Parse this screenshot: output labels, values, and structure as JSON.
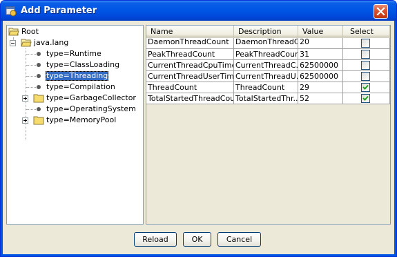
{
  "window": {
    "title": "Add Parameter"
  },
  "tree": {
    "root_label": "Root",
    "java_lang_label": "java.lang",
    "nodes": [
      {
        "label": "type=Runtime"
      },
      {
        "label": "type=ClassLoading"
      },
      {
        "label": "type=Threading"
      },
      {
        "label": "type=Compilation"
      },
      {
        "label": "type=GarbageCollector"
      },
      {
        "label": "type=OperatingSystem"
      },
      {
        "label": "type=MemoryPool"
      }
    ],
    "selected": "type=Threading"
  },
  "table": {
    "columns": [
      "Name",
      "Description",
      "Value",
      "Select"
    ],
    "rows": [
      {
        "name": "DaemonThreadCount",
        "description": "DaemonThreadC...",
        "value": "20",
        "selected": false
      },
      {
        "name": "PeakThreadCount",
        "description": "PeakThreadCount",
        "value": "31",
        "selected": false
      },
      {
        "name": "CurrentThreadCpuTime",
        "description": "CurrentThreadC...",
        "value": "62500000",
        "selected": false
      },
      {
        "name": "CurrentThreadUserTime",
        "description": "CurrentThreadU...",
        "value": "62500000",
        "selected": false
      },
      {
        "name": "ThreadCount",
        "description": "ThreadCount",
        "value": "29",
        "selected": true
      },
      {
        "name": "TotalStartedThreadCount",
        "description": "TotalStartedThr...",
        "value": "52",
        "selected": true
      }
    ]
  },
  "buttons": {
    "reload": "Reload",
    "ok": "OK",
    "cancel": "Cancel"
  },
  "icons": {
    "app": "app-icon",
    "close": "close-icon",
    "folder_open": "folder-open-icon",
    "folder": "folder-icon"
  },
  "colors": {
    "titlebar": "#0054e3",
    "selection": "#316ac5",
    "close_button": "#d9522d",
    "checkmark": "#21a121"
  }
}
